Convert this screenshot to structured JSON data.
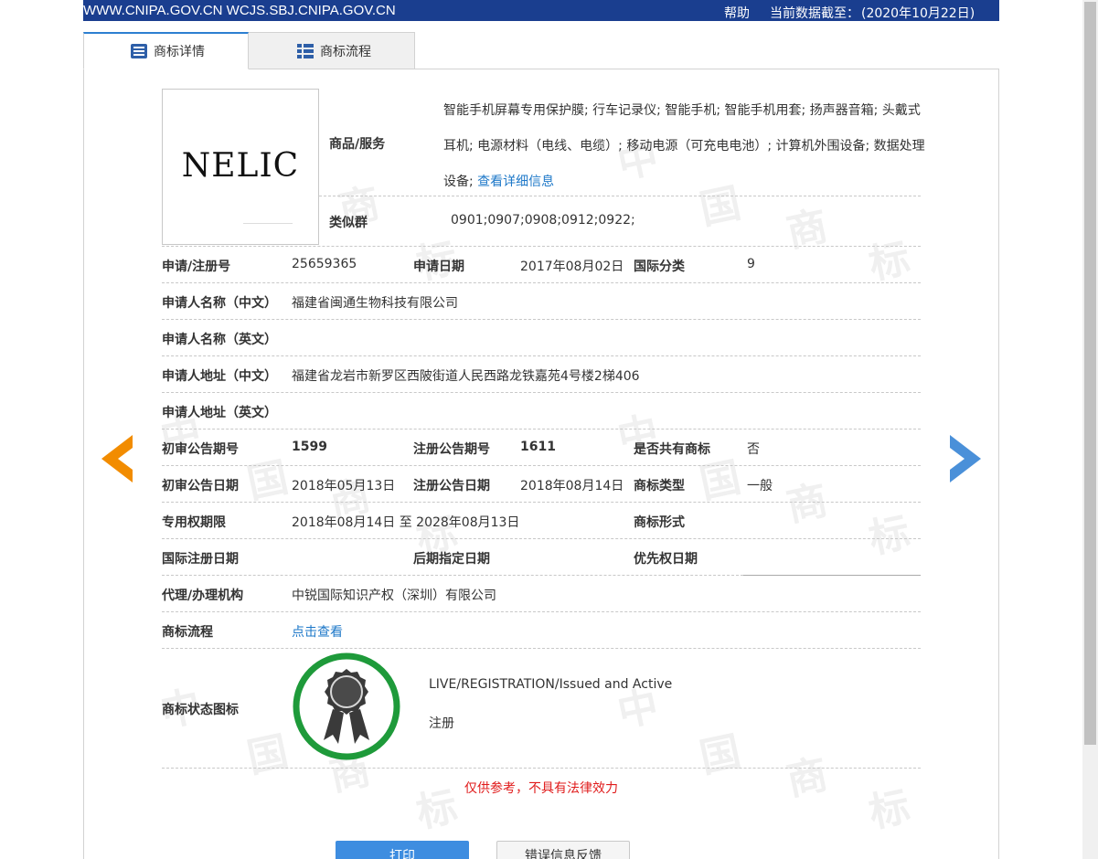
{
  "topbar": {
    "sites": "WWW.CNIPA.GOV.CN WCJS.SBJ.CNIPA.GOV.CN",
    "help": "帮助",
    "date_label": "当前数据截至：",
    "date_value": "(2020年10月22日)"
  },
  "tabs": [
    {
      "label": "商标详情",
      "icon": "list-icon",
      "active": true
    },
    {
      "label": "商标流程",
      "icon": "grid-icon",
      "active": false
    }
  ],
  "watermark": {
    "chars": [
      "中",
      "国",
      "商",
      "标"
    ]
  },
  "trademark": {
    "logo_text": "NELIC",
    "goods_label": "商品/服务",
    "goods_text": "智能手机屏幕专用保护膜; 行车记录仪; 智能手机; 智能手机用套; 扬声器音箱; 头戴式耳机; 电源材料（电线、电缆）; 移动电源（可充电电池）; 计算机外围设备; 数据处理设备;",
    "goods_link": "查看详细信息",
    "similar_label": "类似群",
    "similar_value": "0901;0907;0908;0912;0922;"
  },
  "fields": {
    "reg_no_label": "申请/注册号",
    "reg_no": "25659365",
    "apply_date_label": "申请日期",
    "apply_date": "2017年08月02日",
    "intl_class_label": "国际分类",
    "intl_class": "9",
    "applicant_cn_label": "申请人名称（中文）",
    "applicant_cn": "福建省闽通生物科技有限公司",
    "applicant_en_label": "申请人名称（英文）",
    "applicant_en": "",
    "address_cn_label": "申请人地址（中文）",
    "address_cn": "福建省龙岩市新罗区西陂街道人民西路龙铁嘉苑4号楼2梯406",
    "address_en_label": "申请人地址（英文）",
    "address_en": "",
    "prelim_issue_label": "初审公告期号",
    "prelim_issue": "1599",
    "reg_issue_label": "注册公告期号",
    "reg_issue": "1611",
    "shared_label": "是否共有商标",
    "shared": "否",
    "prelim_date_label": "初审公告日期",
    "prelim_date": "2018年05月13日",
    "reg_date_label": "注册公告日期",
    "reg_date": "2018年08月14日",
    "type_label": "商标类型",
    "type": "一般",
    "term_label": "专用权期限",
    "term": "2018年08月14日 至 2028年08月13日",
    "form_label": "商标形式",
    "intl_reg_date_label": "国际注册日期",
    "later_date_label": "后期指定日期",
    "priority_date_label": "优先权日期",
    "agent_label": "代理/办理机构",
    "agent": "中锐国际知识产权（深圳）有限公司",
    "process_label": "商标流程",
    "process_link": "点击查看",
    "status_label": "商标状态图标",
    "status_en": "LIVE/REGISTRATION/Issued and Active",
    "status_cn": "注册"
  },
  "disclaimer": "仅供参考，不具有法律效力",
  "buttons": {
    "print": "打印",
    "feedback": "错误信息反馈"
  },
  "colors": {
    "topbar": "#1a3e8f",
    "link": "#1e78c8",
    "left_arrow": "#f28c00",
    "right_arrow": "#4a90d9",
    "badge_ring": "#1e9a3a",
    "disclaimer": "#e01b1b"
  }
}
